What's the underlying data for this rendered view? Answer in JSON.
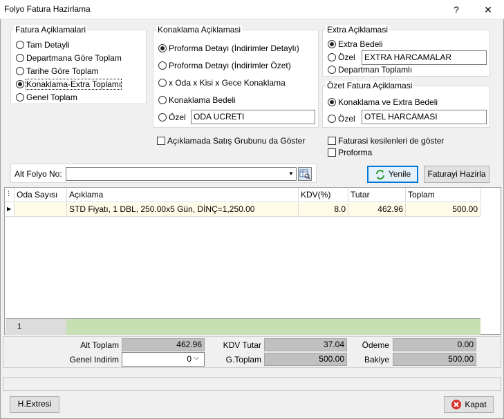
{
  "window": {
    "title": "Folyo Fatura Hazirlama",
    "help": "?",
    "close": "✕"
  },
  "fatura": {
    "label": "Fatura Açiklamalari",
    "options": [
      "Tam Detayli",
      "Departmana Göre Toplam",
      "Tarihe Göre Toplam",
      "Konaklama-Extra Toplamı",
      "Genel Toplam"
    ],
    "selected": 3
  },
  "konaklama": {
    "label": "Konaklama Açiklamasi",
    "options": [
      "Proforma Detayı  (İndirimler Detaylı)",
      "Proforma Detayı (İndirimler Özet)",
      "x Oda x Kisi x Gece Konaklama",
      "Konaklama Bedeli",
      "Özel"
    ],
    "selected": 0,
    "ozel_value": "ODA UCRETI"
  },
  "extra": {
    "label": "Extra Açiklamasi",
    "options": [
      "Extra Bedeli",
      "Özel",
      "Departman Toplamlı"
    ],
    "selected": 0,
    "ozel_value": "EXTRA HARCAMALAR"
  },
  "ozet": {
    "label": "Özet Fatura Açiklamasi",
    "options": [
      "Konaklama ve Extra Bedeli",
      "Özel"
    ],
    "selected": 0,
    "ozel_value": "OTEL HARCAMASI"
  },
  "checks": {
    "satis": "Açıklamada Satış Grubunu da Göster",
    "kesilen": "Faturasi kesilenleri de göster",
    "proforma": "Proforma"
  },
  "altfolyo": {
    "label": "Alt Folyo No:",
    "value": ""
  },
  "buttons": {
    "yenile": "Yenile",
    "hazirla": "Faturayi Hazirla",
    "hextresi": "H.Extresi",
    "kapat": "Kapat"
  },
  "grid": {
    "headers": [
      "Oda Sayısı",
      "Açıklama",
      "KDV(%)",
      "Tutar",
      "Toplam"
    ],
    "rows": [
      {
        "oda": "",
        "aciklama": "STD Fiyatı, 1 DBL, 250.00x5 Gün, DİNÇ=1,250.00",
        "kdv": "8.0",
        "tutar": "462.96",
        "toplam": "500.00"
      }
    ],
    "footer_count": "1"
  },
  "totals": {
    "alt_toplam_label": "Alt Toplam",
    "alt_toplam": "462.96",
    "genel_indirim_label": "Genel Indirim",
    "genel_indirim": "0",
    "kdv_tutar_label": "KDV Tutar",
    "kdv_tutar": "37.04",
    "g_toplam_label": "G.Toplam",
    "g_toplam": "500.00",
    "odeme_label": "Ödeme",
    "odeme": "0.00",
    "bakiye_label": "Bakiye",
    "bakiye": "500.00"
  }
}
